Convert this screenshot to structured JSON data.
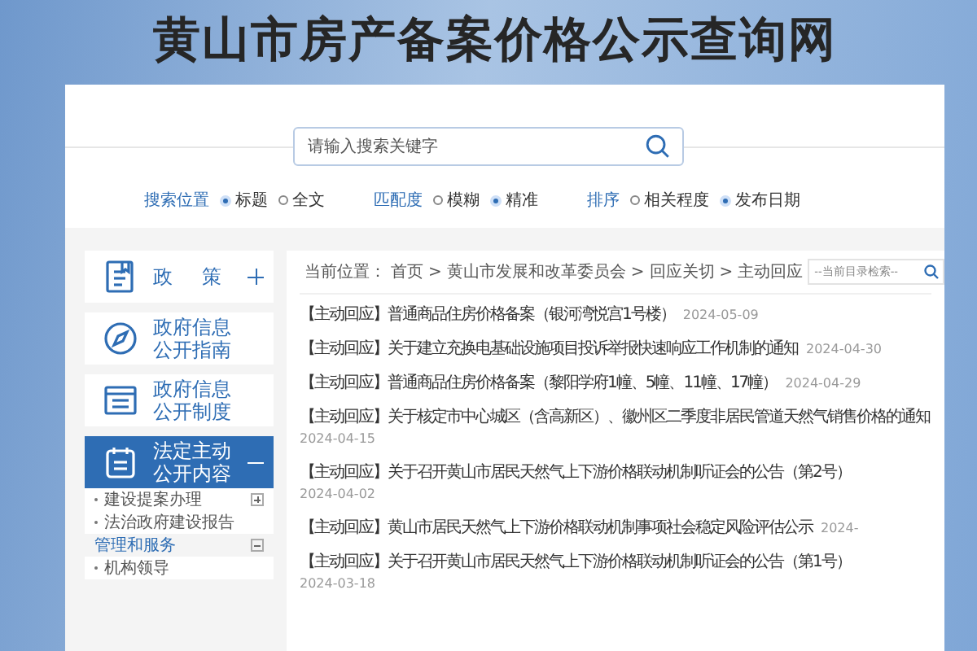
{
  "site_title": "黄山市房产备案价格公示查询网",
  "search": {
    "placeholder": "请输入搜索关键字"
  },
  "search_options": [
    {
      "label": "搜索位置",
      "options": [
        {
          "label": "标题",
          "selected": true
        },
        {
          "label": "全文",
          "selected": false
        }
      ]
    },
    {
      "label": "匹配度",
      "options": [
        {
          "label": "模糊",
          "selected": false
        },
        {
          "label": "精准",
          "selected": true
        }
      ]
    },
    {
      "label": "排序",
      "options": [
        {
          "label": "相关程度",
          "selected": false
        },
        {
          "label": "发布日期",
          "selected": true
        }
      ]
    }
  ],
  "sidebar": {
    "items": [
      {
        "kind": "toggle",
        "label": "政 策",
        "selected": false,
        "expanded": false
      },
      {
        "kind": "link",
        "label": "政府信息公开指南",
        "selected": false
      },
      {
        "kind": "link",
        "label": "政府信息公开制度",
        "selected": false
      },
      {
        "kind": "toggle",
        "label": "法定主动公开内容",
        "selected": true,
        "expanded": true,
        "children": [
          {
            "kind": "toggle",
            "label": "建设提案办理",
            "expanded": false
          },
          {
            "kind": "link",
            "label": "法治政府建设报告"
          },
          {
            "kind": "group",
            "label": "管理和服务",
            "expanded": true,
            "children": [
              {
                "kind": "link",
                "label": "机构领导"
              }
            ]
          }
        ]
      }
    ]
  },
  "breadcrumb": {
    "label": "当前位置：",
    "separator": ">",
    "path": [
      "首页",
      "黄山市发展和改革委员会",
      "回应关切",
      "主动回应"
    ]
  },
  "list_search": {
    "placeholder": "--当前目录检索--"
  },
  "articles": [
    {
      "title": "【主动回应】普通商品住房价格备案（银河湾悦宫1号楼）",
      "date": "2024-05-09"
    },
    {
      "title": "【主动回应】关于建立充换电基础设施项目投诉举报快速响应工作机制的通知",
      "date": "2024-04-30"
    },
    {
      "title": "【主动回应】普通商品住房价格备案（黎阳学府1幢、5幢、11幢、17幢）",
      "date": "2024-04-29"
    },
    {
      "title": "【主动回应】关于核定市中心城区（含高新区）、徽州区二季度非居民管道天然气销售价格的通知",
      "date": "2024-04-15"
    },
    {
      "title": "【主动回应】关于召开黄山市居民天然气上下游价格联动机制听证会的公告（第2号）",
      "date": "2024-04-02"
    },
    {
      "title": "【主动回应】黄山市居民天然气上下游价格联动机制事项社会稳定风险评估公示",
      "date": "2024-"
    },
    {
      "title": "【主动回应】关于召开黄山市居民天然气上下游价格联动机制听证会的公告（第1号）",
      "date": "2024-03-18"
    }
  ]
}
